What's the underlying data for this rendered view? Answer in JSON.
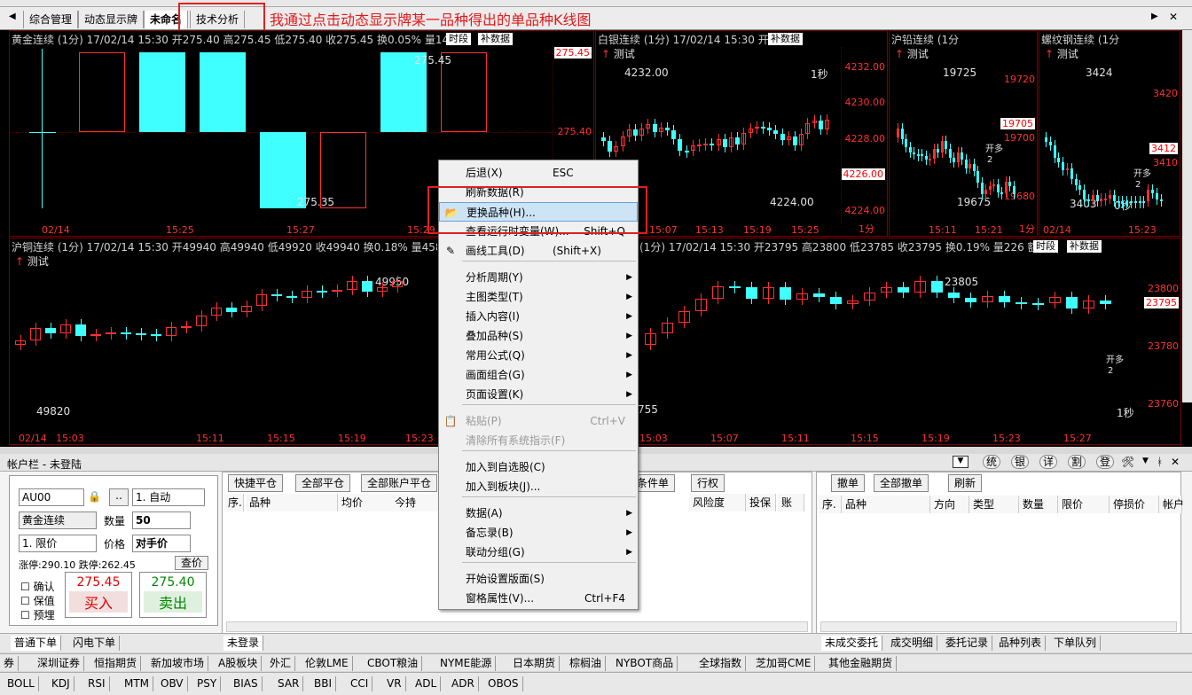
{
  "tabs": [
    "综合管理",
    "动态显示牌",
    "未命名",
    "技术分析"
  ],
  "annotation_note": "我通过点击动态显示牌某一品种得出的单品种K线图",
  "panels": {
    "gold": {
      "title": "黄金连续 (1分) 17/02/14 15:30 开275.40 高275.45 低275.40 收275.45 换0.05% 量148",
      "btn1": "时段",
      "btn2": "补数据",
      "labels": [
        "275.45",
        "275.40"
      ],
      "marks": [
        "275.45",
        "275.35"
      ],
      "xlabels": [
        "02/14",
        "15:25",
        "15:27",
        "15:29"
      ]
    },
    "silver": {
      "title": "白银连续 (1分) 17/02/14 15:30 开",
      "btn": "补数据",
      "test": "测试",
      "yl": [
        "4232.00",
        "4230.00",
        "4228.00",
        "4226.00",
        "4224.00"
      ],
      "hi": "4232.00",
      "lo": "4224.00",
      "sec": "1秒",
      "xl": [
        "15:07",
        "15:13",
        "15:19",
        "15:25",
        "1分"
      ]
    },
    "lead": {
      "title": "沪铅连续 (1分",
      "test": "测试",
      "yl": [
        "19720",
        "19705",
        "19700",
        "19680"
      ],
      "hi": "19725",
      "lo": "19675",
      "kd": "开多",
      "two": "2",
      "xl": [
        "15:11",
        "15:21",
        "1分"
      ]
    },
    "rebar": {
      "title": "螺纹钢连续 (1分",
      "test": "测试",
      "yl": [
        "3420",
        "3412",
        "3410"
      ],
      "hi": "3424",
      "lo": "3403",
      "kd": "开多",
      "two": "2",
      "zero": "0秒",
      "xl": [
        "02/14",
        "15:23"
      ]
    },
    "copper": {
      "title": "沪铜连续 (1分) 17/02/14 15:30 开49940 高49940 低49920 收49940 换0.18% 量458",
      "test": "测试",
      "hi": "49950",
      "lo": "49820",
      "xl": [
        "02/14",
        "15:03",
        "15:11",
        "15:15",
        "15:19",
        "15:23"
      ]
    },
    "rubber": {
      "title": "(1分) 17/02/14 15:30 开23795 高23800 低23785 收23795 换0.19% 量226 额2",
      "btn1": "时段",
      "btn2": "补数据",
      "yl": [
        "23800",
        "23795",
        "23780",
        "23760"
      ],
      "hi": "23805",
      "lo": "755",
      "kd": "开多",
      "two": "2",
      "sec": "1秒",
      "xl": [
        "15:03",
        "15:07",
        "15:11",
        "15:15",
        "15:19",
        "15:23",
        "15:27"
      ]
    }
  },
  "menu": [
    {
      "label": "后退(X)",
      "sc": "ESC"
    },
    {
      "label": "刷新数据(R)"
    },
    {
      "label": "更换品种(H)...",
      "selected": true
    },
    {
      "label": "查看运行时变量(W)...",
      "scr": "Shift+Q"
    },
    {
      "label": "画线工具(D)",
      "sc": "(Shift+X)"
    },
    {
      "label": "分析周期(Y)",
      "arrow": true
    },
    {
      "label": "主图类型(T)",
      "arrow": true
    },
    {
      "label": "插入内容(I)",
      "arrow": true
    },
    {
      "label": "叠加品种(S)",
      "arrow": true
    },
    {
      "label": "常用公式(Q)",
      "arrow": true
    },
    {
      "label": "画面组合(G)",
      "arrow": true
    },
    {
      "label": "页面设置(K)",
      "arrow": true
    },
    {
      "label": "粘贴(P)",
      "scr": "Ctrl+V",
      "disabled": true
    },
    {
      "label": "清除所有系统指示(F)",
      "disabled": true
    },
    {
      "label": "加入到自选股(C)"
    },
    {
      "label": "加入到板块(J)..."
    },
    {
      "label": "数据(A)",
      "arrow": true
    },
    {
      "label": "备忘录(B)",
      "arrow": true
    },
    {
      "label": "联动分组(G)",
      "arrow": true
    },
    {
      "label": "开始设置版面(S)"
    },
    {
      "label": "窗格属性(V)...",
      "scr": "Ctrl+F4"
    }
  ],
  "account": {
    "title": "帐户栏 - 未登陆",
    "code": "AU00",
    "mode": "1. 自动",
    "name": "黄金连续",
    "qty_label": "数量",
    "qty": "50",
    "type": "1. 限价",
    "price_label": "价格",
    "price": "对手价",
    "limits": "涨停:290.10 跌停:262.45",
    "query": "查价",
    "confirm": "确认",
    "keep": "保值",
    "pre": "预埋",
    "buy_price": "275.45",
    "buy": "买入",
    "sell_price": "275.40",
    "sell": "卖出",
    "right_btns": [
      "统",
      "银",
      "详",
      "割",
      "登"
    ]
  },
  "pos_buttons": [
    "快捷平仓",
    "全部平仓",
    "全部账户平仓",
    "条件单",
    "行权"
  ],
  "pos_headers": [
    "序.",
    "品种",
    "均价",
    "今持",
    "风险度",
    "投保",
    "账"
  ],
  "order_buttons": [
    "撤单",
    "全部撤单",
    "刷新"
  ],
  "order_headers": [
    "序.",
    "品种",
    "方向",
    "类型",
    "数量",
    "限价",
    "停损价",
    "帐户"
  ],
  "lower_tabs_left": [
    "普通下单",
    "闪电下单"
  ],
  "not_logged": "未登录",
  "lower_tabs_right": [
    "未成交委托",
    "成交明细",
    "委托记录",
    "品种列表",
    "下单队列"
  ],
  "market_tabs": [
    "券",
    "深圳证券",
    "恒指期货",
    "新加坡市场",
    "A股板块",
    "外汇",
    "伦敦LME",
    "CBOT粮油",
    "NYME能源",
    "日本期货",
    "棕榈油",
    "NYBOT商品",
    "全球指数",
    "芝加哥CME",
    "其他金融期货"
  ],
  "indicators": [
    "BOLL",
    "KDJ",
    "RSI",
    "MTM",
    "OBV",
    "PSY",
    "BIAS",
    "SAR",
    "BBI",
    "CCI",
    "VR",
    "ADL",
    "ADR",
    "OBOS"
  ],
  "colors": {
    "up": "#ff3030",
    "down": "#40ffff",
    "grid": "#5a0000",
    "menu_sel": "#cde4f7"
  }
}
